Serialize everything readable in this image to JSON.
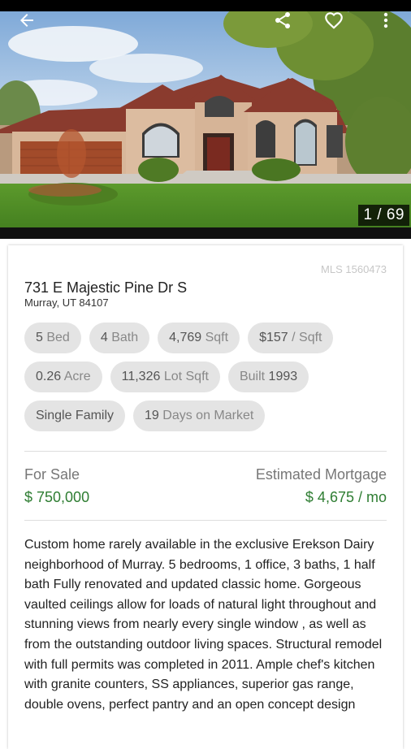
{
  "gallery": {
    "counter": "1 / 69"
  },
  "icons": {
    "back": "arrow-back-icon",
    "share": "share-icon",
    "favorite": "heart-outline-icon",
    "menu": "more-vert-icon"
  },
  "listing": {
    "mls": "MLS 1560473",
    "address": "731 E Majestic Pine Dr S",
    "city": "Murray, UT 84107"
  },
  "facts": {
    "beds": {
      "value": "5",
      "unit": "Bed"
    },
    "baths": {
      "value": "4",
      "unit": "Bath"
    },
    "sqft": {
      "value": "4,769",
      "unit": "Sqft"
    },
    "price_per_sqft": {
      "value": "$157",
      "unit": "/ Sqft"
    },
    "acre": {
      "value": "0.26",
      "unit": "Acre"
    },
    "lot": {
      "value": "11,326",
      "unit": "Lot Sqft"
    },
    "built": {
      "label": "Built",
      "value": "1993"
    },
    "type": "Single Family",
    "days": {
      "value": "19",
      "unit": "Days on Market"
    }
  },
  "pricing": {
    "status": "For Sale",
    "price": "$ 750,000",
    "mortgage_label": "Estimated Mortgage",
    "mortgage_value": "$ 4,675 / mo"
  },
  "description": "Custom home rarely available in the exclusive Erekson Dairy neighborhood of Murray. 5 bedrooms, 1 office, 3 baths, 1 half bath Fully renovated and updated classic home. Gorgeous vaulted ceilings allow for loads of natural light throughout and stunning views from nearly every single window , as well as from the outstanding outdoor living spaces. Structural remodel with full permits was completed in 2011. Ample chef's kitchen with granite counters, SS appliances, superior gas range, double ovens, perfect pantry and an open concept design",
  "colors": {
    "accent_green": "#2e7d32",
    "chip_bg": "#e4e4e4",
    "muted_text": "#777777"
  }
}
